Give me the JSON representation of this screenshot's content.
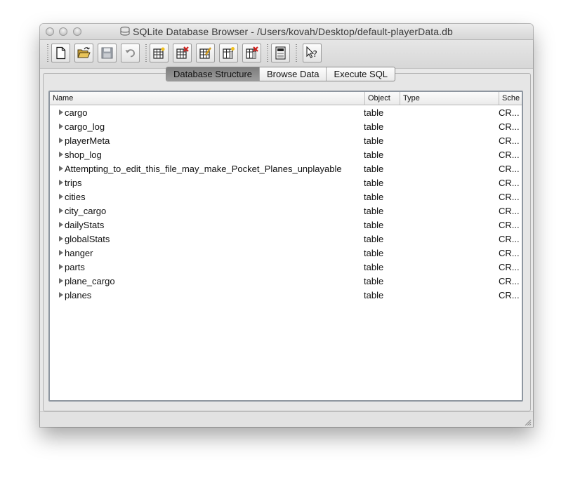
{
  "window": {
    "title": "SQLite Database Browser - /Users/kovah/Desktop/default-playerData.db"
  },
  "toolbar": {
    "buttons": [
      {
        "name": "new-database-button",
        "icon": "new-document-icon"
      },
      {
        "name": "open-database-button",
        "icon": "open-folder-icon"
      },
      {
        "name": "save-changes-button",
        "icon": "save-disk-icon"
      },
      {
        "name": "revert-changes-button",
        "icon": "undo-icon"
      },
      {
        "name": "create-table-button",
        "icon": "create-table-icon"
      },
      {
        "name": "delete-table-button",
        "icon": "delete-table-icon"
      },
      {
        "name": "modify-table-button",
        "icon": "modify-table-icon"
      },
      {
        "name": "create-index-button",
        "icon": "create-index-icon"
      },
      {
        "name": "delete-index-button",
        "icon": "delete-index-icon"
      },
      {
        "name": "sql-log-button",
        "icon": "log-icon"
      },
      {
        "name": "whats-this-button",
        "icon": "whats-this-icon"
      }
    ]
  },
  "tabs": [
    {
      "label": "Database Structure",
      "active": true
    },
    {
      "label": "Browse Data",
      "active": false
    },
    {
      "label": "Execute SQL",
      "active": false
    }
  ],
  "table": {
    "columns": {
      "name": "Name",
      "object": "Object",
      "type": "Type",
      "schema": "Sche"
    },
    "rows": [
      {
        "name": "cargo",
        "object": "table",
        "schema": "CR..."
      },
      {
        "name": "cargo_log",
        "object": "table",
        "schema": "CR..."
      },
      {
        "name": "playerMeta",
        "object": "table",
        "schema": "CR..."
      },
      {
        "name": "shop_log",
        "object": "table",
        "schema": "CR..."
      },
      {
        "name": "Attempting_to_edit_this_file_may_make_Pocket_Planes_unplayable",
        "object": "table",
        "schema": "CR..."
      },
      {
        "name": "trips",
        "object": "table",
        "schema": "CR..."
      },
      {
        "name": "cities",
        "object": "table",
        "schema": "CR..."
      },
      {
        "name": "city_cargo",
        "object": "table",
        "schema": "CR..."
      },
      {
        "name": "dailyStats",
        "object": "table",
        "schema": "CR..."
      },
      {
        "name": "globalStats",
        "object": "table",
        "schema": "CR..."
      },
      {
        "name": "hanger",
        "object": "table",
        "schema": "CR..."
      },
      {
        "name": "parts",
        "object": "table",
        "schema": "CR..."
      },
      {
        "name": "plane_cargo",
        "object": "table",
        "schema": "CR..."
      },
      {
        "name": "planes",
        "object": "table",
        "schema": "CR..."
      }
    ]
  }
}
